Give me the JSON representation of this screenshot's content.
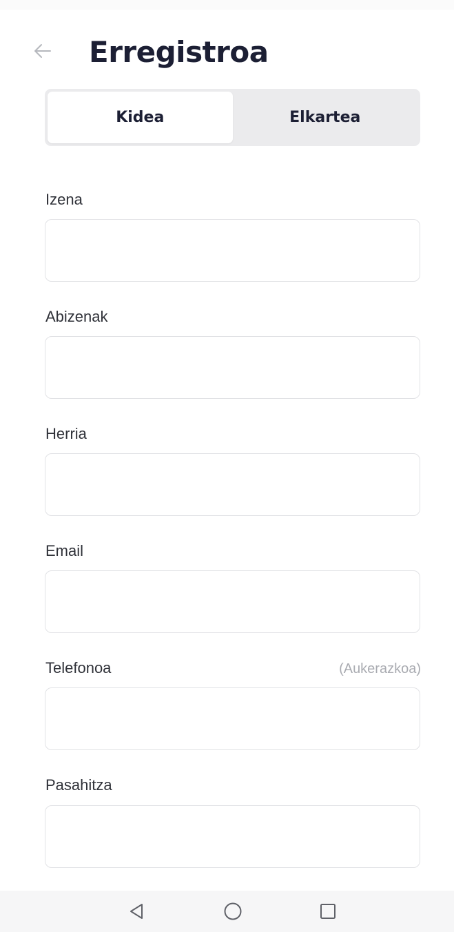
{
  "header": {
    "title": "Erregistroa",
    "back_icon": "arrow-left-icon"
  },
  "tabs": [
    {
      "label": "Kidea",
      "selected": true
    },
    {
      "label": "Elkartea",
      "selected": false
    }
  ],
  "form": {
    "fields": [
      {
        "label": "Izena",
        "value": "",
        "optional_note": ""
      },
      {
        "label": "Abizenak",
        "value": "",
        "optional_note": ""
      },
      {
        "label": "Herria",
        "value": "",
        "optional_note": ""
      },
      {
        "label": "Email",
        "value": "",
        "optional_note": ""
      },
      {
        "label": "Telefonoa",
        "value": "",
        "optional_note": "(Aukerazkoa)"
      },
      {
        "label": "Pasahitza",
        "value": "",
        "optional_note": ""
      }
    ]
  },
  "navbar": {
    "icons": [
      "back-triangle-icon",
      "home-circle-icon",
      "recents-square-icon"
    ]
  },
  "colors": {
    "title": "#1c1f34",
    "segment_bg": "#ebebed",
    "input_border": "#e1e2e5",
    "optional_text": "#a9abb1"
  }
}
